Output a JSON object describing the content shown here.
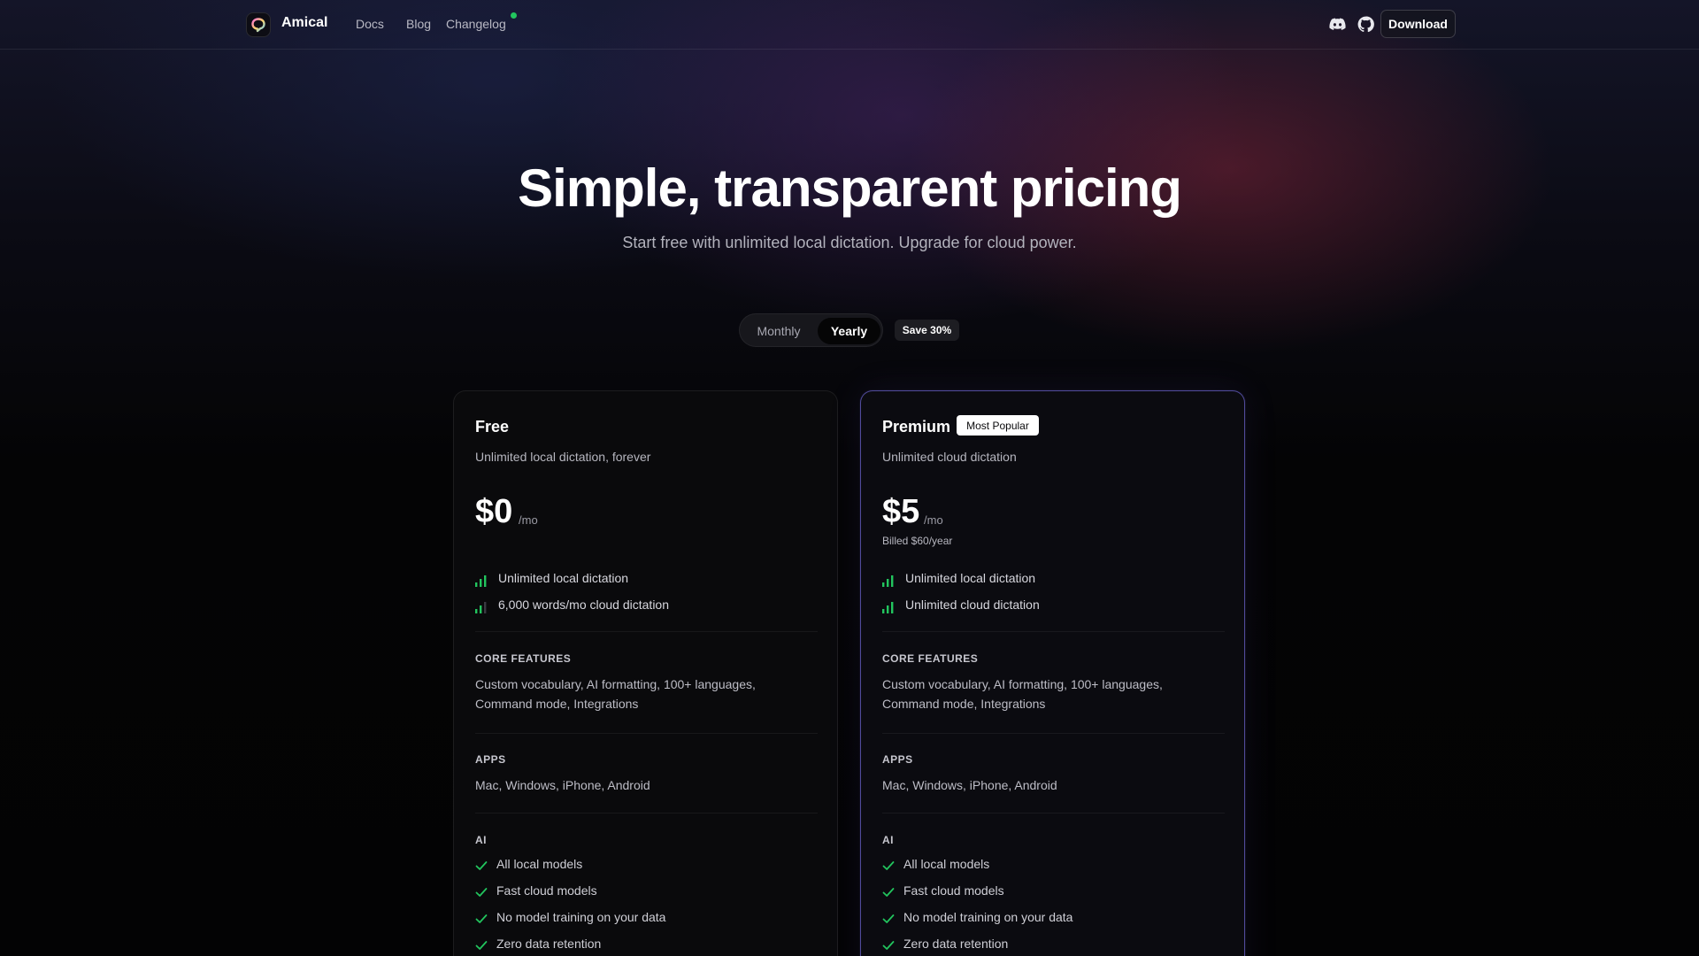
{
  "colors": {
    "accent_green": "#22c55e",
    "premium_border": "#786ee6",
    "background": "#030304"
  },
  "nav": {
    "brand": "Amical",
    "links": [
      "Docs",
      "Blog",
      "Changelog"
    ],
    "download_label": "Download",
    "icons": [
      "discord-icon",
      "github-icon"
    ]
  },
  "hero": {
    "title": "Simple, transparent pricing",
    "subtitle": "Start free with unlimited local dictation. Upgrade for cloud power."
  },
  "billing_toggle": {
    "options": [
      "Monthly",
      "Yearly"
    ],
    "selected": "Yearly",
    "badge": "Save 30%"
  },
  "plans": [
    {
      "name": "Free",
      "badge": "",
      "description": "Unlimited local dictation, forever",
      "price": "$0",
      "period": "/mo",
      "billed": "",
      "usage": [
        "Unlimited local dictation",
        "6,000 words/mo cloud dictation"
      ],
      "core_title": "CORE FEATURES",
      "core_text": "Custom vocabulary, AI formatting, 100+ languages, Command mode, Integrations",
      "apps_title": "APPS",
      "apps_text": "Mac, Windows, iPhone, Android",
      "ai_title": "AI",
      "ai_items": [
        "All local models",
        "Fast cloud models",
        "No model training on your data",
        "Zero data retention"
      ]
    },
    {
      "name": "Premium",
      "badge": "Most Popular",
      "description": "Unlimited cloud dictation",
      "price": "$5",
      "period": "/mo",
      "billed": "Billed $60/year",
      "usage": [
        "Unlimited local dictation",
        "Unlimited cloud dictation"
      ],
      "core_title": "CORE FEATURES",
      "core_text": "Custom vocabulary, AI formatting, 100+ languages, Command mode, Integrations",
      "apps_title": "APPS",
      "apps_text": "Mac, Windows, iPhone, Android",
      "ai_title": "AI",
      "ai_items": [
        "All local models",
        "Fast cloud models",
        "No model training on your data",
        "Zero data retention"
      ]
    }
  ]
}
